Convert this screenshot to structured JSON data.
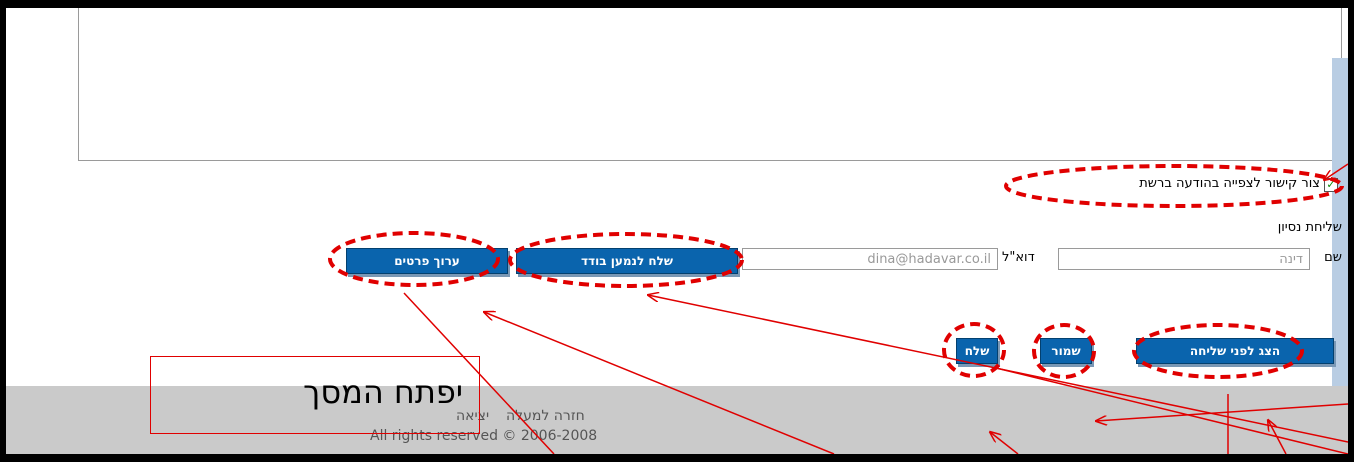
{
  "form": {
    "checkbox_label": "צור קישור לצפייה בהודעה ברשת",
    "checkbox_checked": true,
    "test_send_title": "שליחת נסיון",
    "name_label": "שם",
    "name_value": "דינה",
    "email_label": "דוא\"ל",
    "email_value": "dina@hadavar.co.il",
    "send_single_button": "שלח לנמען בודד",
    "edit_details_button": "ערוך פרטים"
  },
  "actions": {
    "preview_button": "הצג לפני שליחה",
    "save_button": "שמור",
    "send_button": "שלח"
  },
  "footer": {
    "back_to_top": "חזרה למעלה",
    "exit": "יציאה",
    "copyright": "All rights reserved © 2006-2008"
  },
  "annotation": {
    "callout_text": "יפתח המסך",
    "color": "#e00000"
  }
}
